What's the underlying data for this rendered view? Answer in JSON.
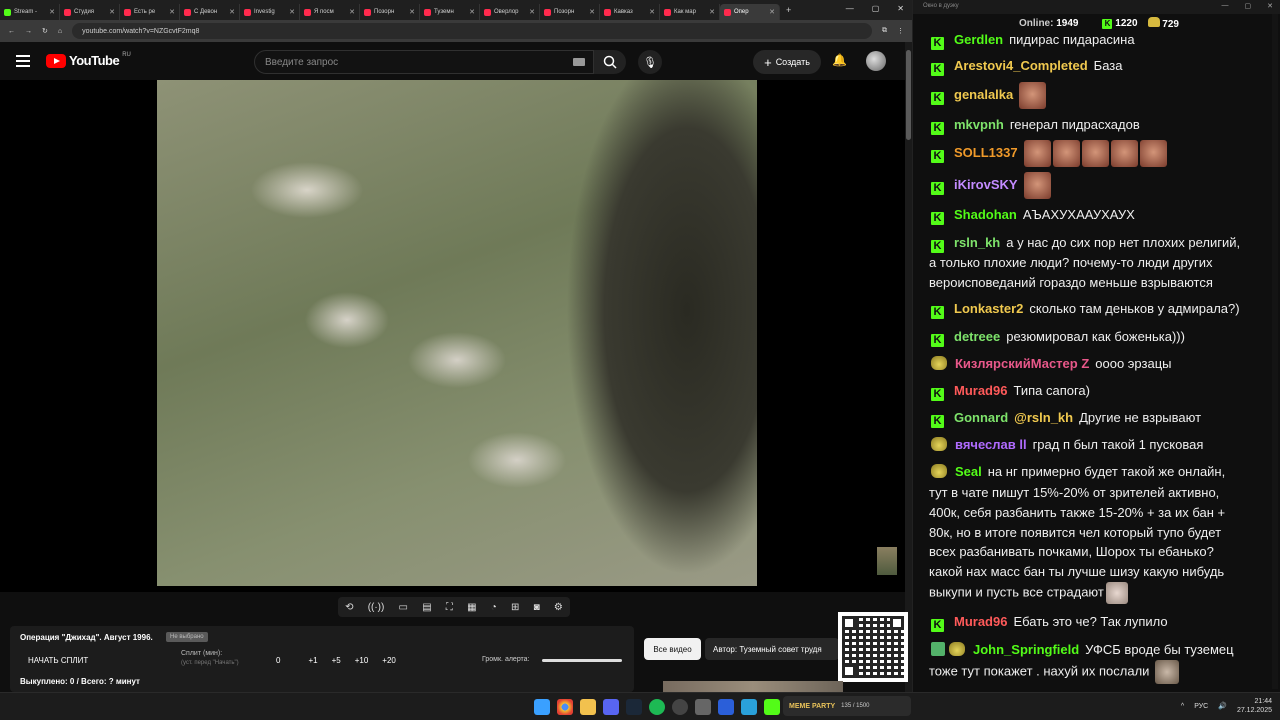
{
  "browser": {
    "tabs": [
      "Stream -",
      "Студия",
      "Есть ре",
      "С Девон",
      "Investig",
      "Я посм",
      "Позорн",
      "Туземн",
      "Оверлор",
      "Позорн",
      "Кавказ",
      "Как мар",
      "Опер"
    ],
    "url": "youtube.com/watch?v=NZGcvtF2mq8",
    "window_controls": [
      "—",
      "▢",
      "✕"
    ]
  },
  "youtube": {
    "logo_text": "YouTube",
    "region": "RU",
    "search_placeholder": "Введите запрос",
    "create_label": "Создать"
  },
  "player_panel": {
    "video_title": "Операция \"Джихад\". Август 1996.",
    "badge": "Не выбрано",
    "start_split": "НАЧАТЬ СПЛИТ",
    "split_label": "Сплит (мин):",
    "split_hint": "(уст. перед \"Начать\")",
    "split_options": [
      "0",
      "+1",
      "+5",
      "+10",
      "+20"
    ],
    "alert_volume": "Громк. алерта:",
    "bought": "Выкуплено: 0 / Всего: ? минут",
    "alert_volume_level": 1.0
  },
  "buttons": {
    "all_videos": "Все видео",
    "author": "Автор: Туземный совет трудя"
  },
  "chat": {
    "header": "Окно в дуэку",
    "online_label": "Online:",
    "online_count": "1949",
    "kick_count": "1220",
    "bank_count": "729",
    "messages": [
      {
        "user": "Gerdlen",
        "text": "пидирас пидарасина",
        "color": "#53fc18"
      },
      {
        "user": "Arestovi4_Completed",
        "text": "База",
        "color": "#f0c94f"
      },
      {
        "user": "genalalka",
        "text": "",
        "color": "#f0c94f"
      },
      {
        "user": "mkvpnh",
        "text": "генерал пидрасхадов",
        "color": "#7ee36b"
      },
      {
        "user": "SOLL1337",
        "text": "",
        "color": "#f09a2a"
      },
      {
        "user": "iKirovSKY",
        "text": "",
        "color": "#c38bff"
      },
      {
        "user": "Shadohan",
        "text": "АЪАХУХААУХАУХ",
        "color": "#53fc18"
      },
      {
        "user": "rsln_kh",
        "text": "а у нас до сих пор нет плохих религий,",
        "color": "#7ee36b"
      },
      {
        "user": "",
        "text": "а только плохие люди? почему-то люди других",
        "color": "#fff"
      },
      {
        "user": "",
        "text": "вероисповеданий гораздо меньше взрываются",
        "color": "#fff"
      },
      {
        "user": "Lonkaster2",
        "text": "сколько там деньков у адмирала?)",
        "color": "#f0c94f"
      },
      {
        "user": "detreee",
        "text": "резюмировал как боженька)))",
        "color": "#7ee36b"
      },
      {
        "user": "КизлярскийМастер Z",
        "text": "оооо эрзацы",
        "color": "#e8588a"
      },
      {
        "user": "Murad96",
        "text": "Типа сапога)",
        "color": "#ff5a5a"
      },
      {
        "user": "Gonnard",
        "mention": "@rsln_kh",
        "text": "Другие не взрывают",
        "color": "#7ee36b"
      },
      {
        "user": "вячеслав ll",
        "text": "град п  был такой  1 пусковая",
        "color": "#b06bff"
      },
      {
        "user": "Seal",
        "text": "на нг примерно будет такой же онлайн,",
        "color": "#53fc18"
      },
      {
        "user": "",
        "text": "тут в чате пишут 15%-20% от зрителей активно,",
        "color": "#fff"
      },
      {
        "user": "",
        "text": "400к, себя разбанить также 15-20% + за их бан +",
        "color": "#fff"
      },
      {
        "user": "",
        "text": "80к, но в итоге появится чел который тупо будет",
        "color": "#fff"
      },
      {
        "user": "",
        "text": "всех разбанивать почками, Шорох ты ебанько?",
        "color": "#fff"
      },
      {
        "user": "",
        "text": "какой нах масс бан ты лучше шизу какую нибудь",
        "color": "#fff"
      },
      {
        "user": "",
        "text": "выкупи и пусть все страдают",
        "color": "#fff"
      },
      {
        "user": "Murad96",
        "text": "Ебать это че? Так лупило",
        "color": "#ff5a5a"
      },
      {
        "user": "John_Springfield",
        "text": "УФСБ вроде бы туземец",
        "color": "#53fc18"
      },
      {
        "user": "",
        "text": "тоже тут покажет . нахуй их послали",
        "color": "#fff"
      }
    ]
  },
  "taskbar": {
    "widget_title": "MEME PARTY",
    "widget_progress": "135 / 1500",
    "lang": "РУС",
    "time": "21:44",
    "date": "27.12.2025"
  },
  "colors": {
    "kick_green": "#53fc18",
    "youtube_red": "#ff0000"
  }
}
